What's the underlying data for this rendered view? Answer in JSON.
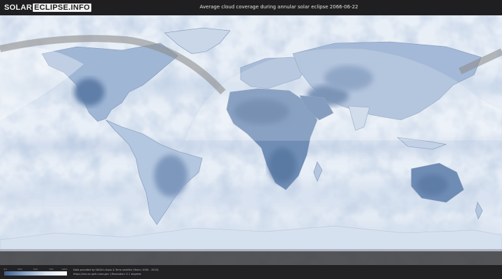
{
  "header": {
    "logo_part1": "SOLAR",
    "logo_part2": "ECLIPSE.INFO",
    "title": "Average cloud coverage during annular solar eclipse 2066-06-22"
  },
  "map": {
    "colors": {
      "ocean_clear": "#eef3f9",
      "cloud_light": "#c6d6e8",
      "cloud_dense": "#5d7ca6",
      "eclipse_path": "#8e8e8e",
      "night_shade": "#2b2b2b"
    }
  },
  "legend": {
    "scale_labels": [
      "0%",
      "25%",
      "50%",
      "75%",
      "100%"
    ],
    "credit_line1": "Data provided by NASA's Aqua & Terra satellite (Years: 2000 - 2019)",
    "credit_line2": "https://neo.sci.gsfc.nasa.gov | Resolution: 0.1 degrees"
  }
}
